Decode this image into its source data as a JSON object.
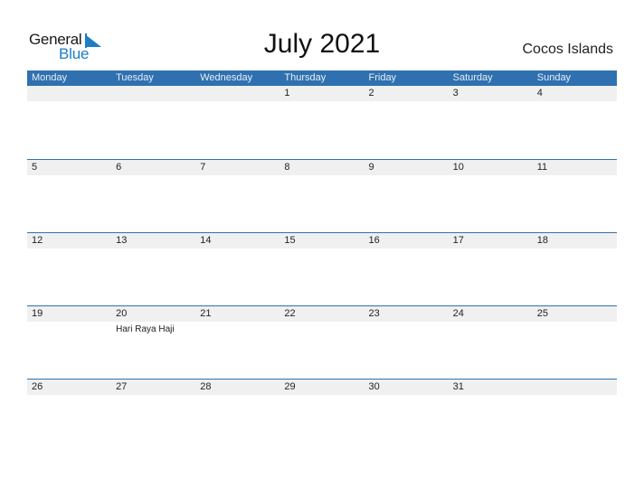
{
  "logo": {
    "line1": "General",
    "line2": "Blue"
  },
  "title": "July 2021",
  "country": "Cocos Islands",
  "colors": {
    "header": "#2f71b0",
    "strip": "#f0f0f0",
    "brand": "#1d7dc6"
  },
  "weekdays": [
    "Monday",
    "Tuesday",
    "Wednesday",
    "Thursday",
    "Friday",
    "Saturday",
    "Sunday"
  ],
  "weeks": [
    {
      "days": [
        "",
        "",
        "",
        "1",
        "2",
        "3",
        "4"
      ],
      "events": [
        "",
        "",
        "",
        "",
        "",
        "",
        ""
      ]
    },
    {
      "days": [
        "5",
        "6",
        "7",
        "8",
        "9",
        "10",
        "11"
      ],
      "events": [
        "",
        "",
        "",
        "",
        "",
        "",
        ""
      ]
    },
    {
      "days": [
        "12",
        "13",
        "14",
        "15",
        "16",
        "17",
        "18"
      ],
      "events": [
        "",
        "",
        "",
        "",
        "",
        "",
        ""
      ]
    },
    {
      "days": [
        "19",
        "20",
        "21",
        "22",
        "23",
        "24",
        "25"
      ],
      "events": [
        "",
        "Hari Raya Haji",
        "",
        "",
        "",
        "",
        ""
      ]
    },
    {
      "days": [
        "26",
        "27",
        "28",
        "29",
        "30",
        "31",
        ""
      ],
      "events": [
        "",
        "",
        "",
        "",
        "",
        "",
        ""
      ]
    }
  ]
}
